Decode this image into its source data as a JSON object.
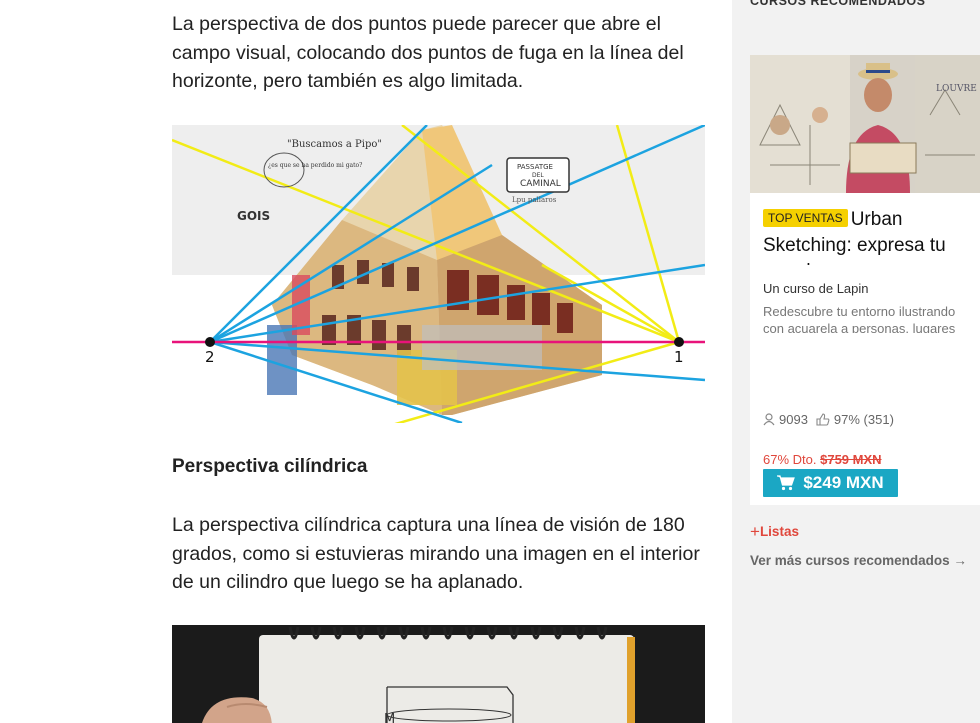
{
  "article": {
    "para1": "La perspectiva de dos puntos puede parecer que abre el campo visual, colocando dos puntos de fuga en la línea del horizonte, pero también es algo limitada.",
    "figure1": {
      "label_left": "2",
      "label_right": "1",
      "sketch_note1": "\"Buscamos a Pipo\"",
      "sketch_note2": "¿es que se ha perdido mi gato?",
      "sign_line1": "PASSATGE",
      "sign_line2": "DEL",
      "sign_line3": "CAMINAL",
      "sign_sub": "Lpu pallaros",
      "cat_label": "GOIS"
    },
    "heading": "Perspectiva cilíndrica",
    "para2": "La perspectiva cilíndrica captura una línea de visión de 180 grados, como si estuvieras mirando una imagen en el interior de un cilindro que luego se ha aplanado.",
    "figure2": {
      "sketch_letter": "M"
    }
  },
  "sidebar": {
    "title": "CURSOS RECOMENDADOS",
    "course": {
      "thumb_text": "LOUVRE",
      "badge": "TOP VENTAS",
      "title": "Urban Sketching: expresa tu mundo con una nueva",
      "author": "Un curso de Lapin",
      "description": "Redescubre tu entorno ilustrando con acuarela a personas, lugares",
      "students": "9093",
      "rating": "97% (351)",
      "discount": "67% Dto.",
      "old_price": "$759 MXN",
      "price": "$249 MXN"
    },
    "lists_label": "Listas",
    "more_label": "Ver más cursos recomendados →"
  },
  "colors": {
    "accent": "#1ba7c4",
    "badge": "#f5d000",
    "discount": "#e0473c",
    "horizon": "#e8137a",
    "line_yellow": "#f2ec16",
    "line_blue": "#1ca3e0"
  }
}
